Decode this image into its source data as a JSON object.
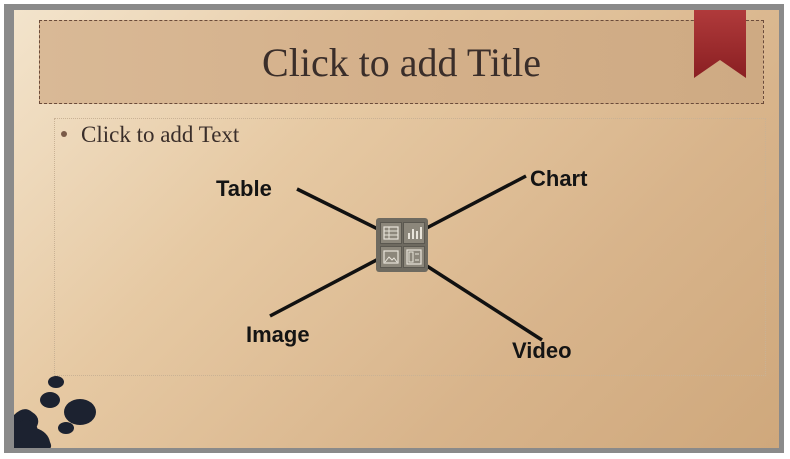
{
  "slide": {
    "title_placeholder": "Click to add Title",
    "text_placeholder": "Click to add Text",
    "accent_color": "#9e2a2b",
    "background_color": "#dcbc96"
  },
  "insert_buttons": [
    {
      "label": "Table",
      "icon": "table-icon"
    },
    {
      "label": "Chart",
      "icon": "chart-icon"
    },
    {
      "label": "Image",
      "icon": "image-icon"
    },
    {
      "label": "Video",
      "icon": "video-icon"
    }
  ]
}
